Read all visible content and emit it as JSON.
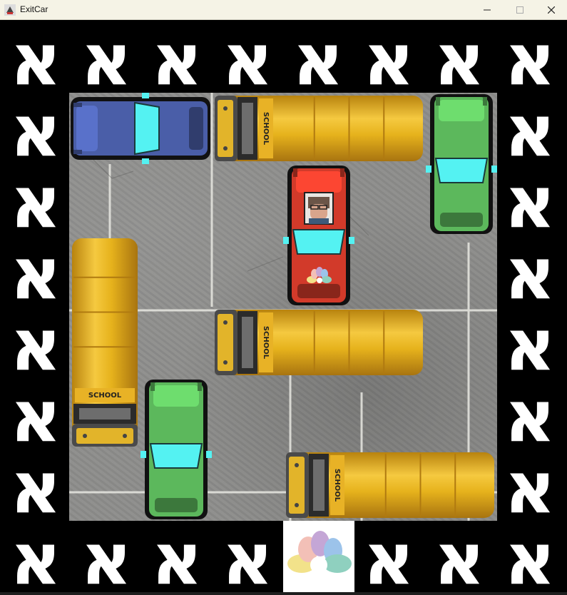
{
  "window": {
    "title": "ExitCar",
    "app_icon": "exitcar-app-icon",
    "controls": {
      "minimize": "minimize-icon",
      "maximize": "maximize-icon",
      "close": "close-icon"
    }
  },
  "board": {
    "border_glyph": "א",
    "border_glyph_name": "hebrew-letter-alef",
    "grid_size": 6,
    "exit_marker": "colorful-flower-logo",
    "colors": {
      "asphalt": "#8d8d8b",
      "school_bus": "#e6b21c",
      "red_car": "#d23a2a",
      "blue_car": "#4a5ea8",
      "green_car": "#5cb85c",
      "window_cyan": "#54f2f2"
    }
  },
  "pieces": [
    {
      "id": "blue-car",
      "type": "car",
      "color": "blue",
      "orientation": "horizontal",
      "row": 0,
      "col": 0,
      "length": 2
    },
    {
      "id": "school-bus-top",
      "type": "school-bus",
      "label": "SCHOOL",
      "orientation": "horizontal",
      "row": 0,
      "col": 2,
      "length": 3
    },
    {
      "id": "green-car-right",
      "type": "car",
      "color": "green",
      "orientation": "vertical",
      "row": 0,
      "col": 5,
      "length": 2
    },
    {
      "id": "red-car",
      "type": "car",
      "color": "red",
      "orientation": "vertical",
      "row": 1,
      "col": 3,
      "length": 2,
      "is_target": true
    },
    {
      "id": "school-bus-left",
      "type": "school-bus",
      "label": "SCHOOL",
      "orientation": "vertical",
      "row": 2,
      "col": 0,
      "length": 3
    },
    {
      "id": "school-bus-middle",
      "type": "school-bus",
      "label": "SCHOOL",
      "orientation": "horizontal",
      "row": 3,
      "col": 2,
      "length": 3
    },
    {
      "id": "green-car-bottom",
      "type": "car",
      "color": "green",
      "orientation": "vertical",
      "row": 4,
      "col": 1,
      "length": 2
    },
    {
      "id": "school-bus-bottom",
      "type": "school-bus",
      "label": "SCHOOL",
      "orientation": "horizontal",
      "row": 5,
      "col": 3,
      "length": 3
    }
  ]
}
